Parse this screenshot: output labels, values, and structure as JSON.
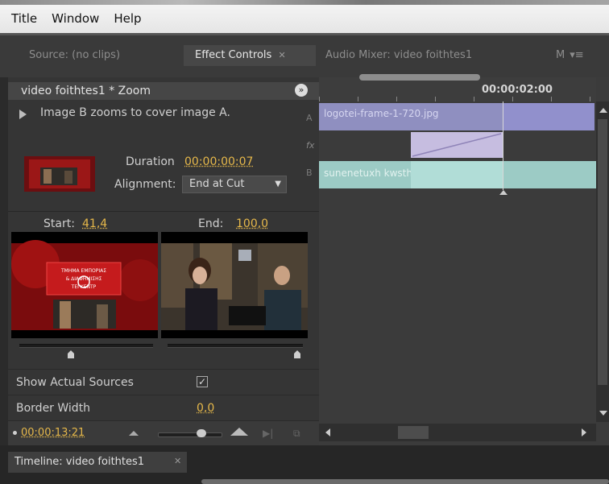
{
  "menubar": {
    "items": [
      "Title",
      "Window",
      "Help"
    ]
  },
  "tabs": {
    "source": "Source: (no clips)",
    "effect_controls": "Effect Controls",
    "audio_mixer": "Audio Mixer: video foithtes1",
    "more": "M"
  },
  "effect_controls": {
    "header_title": "video foithtes1 * Zoom",
    "description": "Image B zooms to cover image A.",
    "duration_label": "Duration",
    "duration_value": "00:00:00:07",
    "alignment_label": "Alignment:",
    "alignment_value": "End at Cut",
    "start_label": "Start:",
    "start_value": "41,4",
    "end_label": "End:",
    "end_value": "100,0",
    "start_slider": 0.41,
    "end_slider": 1.0,
    "show_actual_sources_label": "Show Actual Sources",
    "show_actual_sources_checked": true,
    "border_width_label": "Border Width",
    "border_width_value": "0,0",
    "timecode": "00:00:13:21"
  },
  "timeline_view": {
    "ruler_time": "00:00:02:00",
    "track_a_clip": "logotei-frame-1-720.jpg",
    "track_b_clip": "sunenetuxh kwsths+biki.mpg",
    "track_a_letter": "A",
    "track_fx_letter": "fx",
    "track_b_letter": "B"
  },
  "thumbnail_text": {
    "line1": "ΤΜΗΜΑ ΕΜΠΟΡΙΑΣ",
    "line2": "& ΔΙΑΦΗΜΙΣΗΣ",
    "line3": "ΤΕΙ ΚΕΝΤΡ"
  },
  "bottom_tab": "Timeline: video foithtes1",
  "colors": {
    "accent_orange": "#e6b84a",
    "clip_a": "#8f8fc0",
    "clip_b": "#9ccbc5",
    "transition": "#c6bde0"
  }
}
